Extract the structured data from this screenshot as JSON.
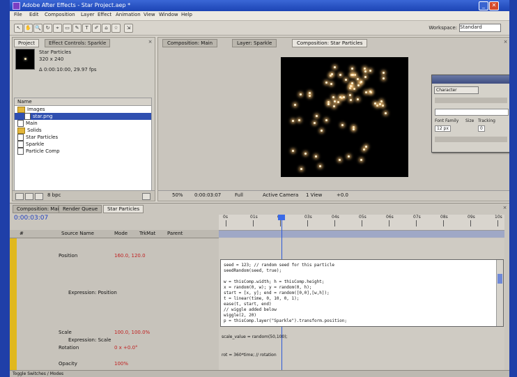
{
  "window": {
    "title": "Adobe After Effects - Star Project.aep *",
    "buttons": [
      "_",
      "□",
      "✕"
    ]
  },
  "menu": [
    "File",
    "Edit",
    "Composition",
    "Layer",
    "Effect",
    "Animation",
    "View",
    "Window",
    "Help"
  ],
  "toolbar": {
    "tools": [
      "↖",
      "✋",
      "🔍",
      "↻",
      "⌖",
      "▭",
      "✎",
      "T",
      "✐",
      "⌂",
      "☆",
      "⇲"
    ],
    "workspace_label": "Workspace:",
    "workspace_value": "Standard"
  },
  "project": {
    "tab": "Project",
    "tab2": "Effect Controls: Sparkle",
    "item_name": "Star Particles",
    "item_size": "320 x 240",
    "item_info": "Δ 0:00:10:00, 29.97 fps",
    "list_header": "Name",
    "items": [
      {
        "name": "Images",
        "type": "folder",
        "selected": false
      },
      {
        "name": "star.png",
        "type": "file",
        "selected": true
      },
      {
        "name": "Main",
        "type": "file",
        "selected": false
      },
      {
        "name": "Solids",
        "type": "folder",
        "selected": false
      },
      {
        "name": "Star Particles",
        "type": "file",
        "selected": false
      },
      {
        "name": "Sparkle",
        "type": "file",
        "selected": false
      },
      {
        "name": "Particle Comp",
        "type": "file",
        "selected": false
      }
    ],
    "footer": "8 bpc"
  },
  "viewer": {
    "tabs": [
      {
        "label": "Composition: Main",
        "active": false
      },
      {
        "label": "Layer: Sparkle",
        "active": false
      },
      {
        "label": "Composition: Star Particles",
        "active": true
      }
    ],
    "bar": [
      "50%",
      "0:00:03:07",
      "Full",
      "Active Camera",
      "1 View",
      "+0.0"
    ]
  },
  "palette": {
    "title": "Character",
    "font_label": "Font Family",
    "size_label": "Size",
    "size_value": "12 px",
    "tracking_label": "Tracking",
    "tracking_value": "0"
  },
  "timeline": {
    "tabs": [
      {
        "label": "Composition: Main",
        "active": false
      },
      {
        "label": "Render Queue",
        "active": false
      },
      {
        "label": "Star Particles",
        "active": true
      }
    ],
    "timecode": "0:00:03:07",
    "layer_header_cols": [
      "#",
      "Source Name",
      "Mode",
      "TrkMat",
      "Parent"
    ],
    "ruler_labels": [
      "0s",
      "01s",
      "02s",
      "03s",
      "04s",
      "05s",
      "06s",
      "07s",
      "08s",
      "09s",
      "10s"
    ],
    "layers": [
      {
        "label": "Position",
        "value": "160.0, 120.0"
      },
      {
        "label": "Expression: Position",
        "value": ""
      },
      {
        "label": "Scale",
        "value": "100.0, 100.0%"
      },
      {
        "label": "Expression: Scale",
        "value": ""
      },
      {
        "label": "Rotation",
        "value": "0 x +0.0°"
      },
      {
        "label": "Opacity",
        "value": "100%"
      }
    ],
    "expression_lines": [
      "seed = 123; // random seed for this particle",
      "seedRandom(seed, true);",
      "",
      "w = thisComp.width; h = thisComp.height;",
      "x = random(0, w); y = random(0, h);",
      "start = [x, y]; end = random([0,0],[w,h]);",
      "t = linear(time, 0, 10, 0, 1);",
      "ease(t, start, end)",
      "// wiggle added below",
      "wiggle(2, 20)",
      "p = thisComp.layer(\"Sparkle\").transform.position;"
    ],
    "track_notes": [
      "scale_value = random(50,100);",
      "rot = 360*time; // rotation"
    ],
    "footer_left": "Toggle Switches / Modes"
  }
}
